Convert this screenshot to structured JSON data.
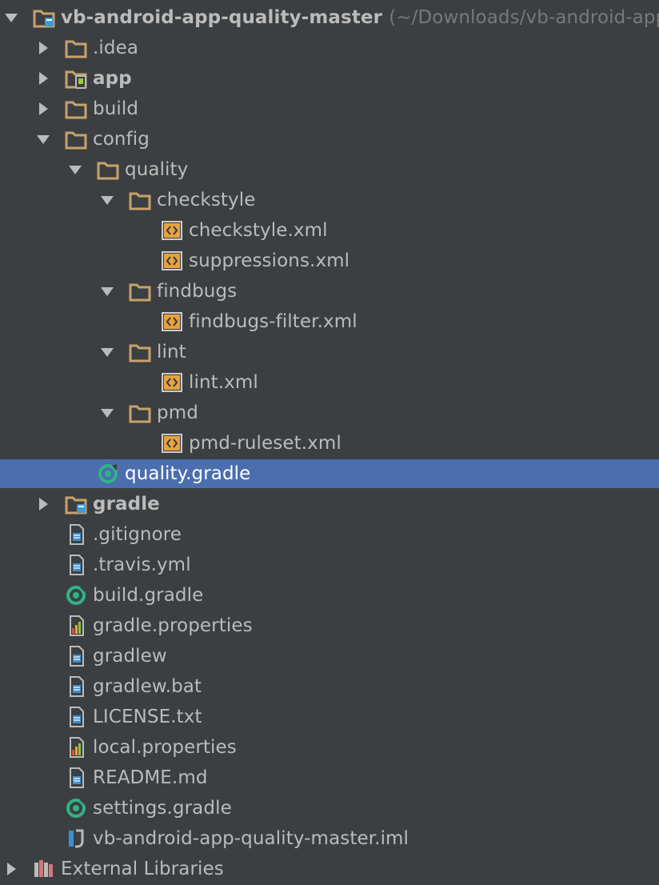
{
  "tree": [
    {
      "label": "vb-android-app-quality-master",
      "path": "(~/Downloads/vb-android-app-quality-master)",
      "icon": "project-module-icon",
      "depth": 0,
      "expand": "open",
      "bold": true
    },
    {
      "label": ".idea",
      "icon": "folder-icon",
      "depth": 1,
      "expand": "closed"
    },
    {
      "label": "app",
      "icon": "android-module-icon",
      "depth": 1,
      "expand": "closed",
      "bold": true
    },
    {
      "label": "build",
      "icon": "folder-icon",
      "depth": 1,
      "expand": "closed"
    },
    {
      "label": "config",
      "icon": "folder-icon",
      "depth": 1,
      "expand": "open"
    },
    {
      "label": "quality",
      "icon": "folder-icon",
      "depth": 2,
      "expand": "open"
    },
    {
      "label": "checkstyle",
      "icon": "folder-icon",
      "depth": 3,
      "expand": "open"
    },
    {
      "label": "checkstyle.xml",
      "icon": "xml-file-icon",
      "depth": 4
    },
    {
      "label": "suppressions.xml",
      "icon": "xml-file-icon",
      "depth": 4
    },
    {
      "label": "findbugs",
      "icon": "folder-icon",
      "depth": 3,
      "expand": "open"
    },
    {
      "label": "findbugs-filter.xml",
      "icon": "xml-file-icon",
      "depth": 4
    },
    {
      "label": "lint",
      "icon": "folder-icon",
      "depth": 3,
      "expand": "open"
    },
    {
      "label": "lint.xml",
      "icon": "xml-file-icon",
      "depth": 4
    },
    {
      "label": "pmd",
      "icon": "folder-icon",
      "depth": 3,
      "expand": "open"
    },
    {
      "label": "pmd-ruleset.xml",
      "icon": "xml-file-icon",
      "depth": 4
    },
    {
      "label": "quality.gradle",
      "icon": "gradle-file-icon",
      "depth": 2,
      "selected": true
    },
    {
      "label": "gradle",
      "icon": "gradle-module-icon",
      "depth": 1,
      "expand": "closed",
      "bold": true
    },
    {
      "label": ".gitignore",
      "icon": "text-file-icon",
      "depth": 1
    },
    {
      "label": ".travis.yml",
      "icon": "text-file-icon",
      "depth": 1
    },
    {
      "label": "build.gradle",
      "icon": "gradle-file-icon",
      "depth": 1
    },
    {
      "label": "gradle.properties",
      "icon": "properties-file-icon",
      "depth": 1
    },
    {
      "label": "gradlew",
      "icon": "text-file-icon",
      "depth": 1
    },
    {
      "label": "gradlew.bat",
      "icon": "text-file-icon",
      "depth": 1
    },
    {
      "label": "LICENSE.txt",
      "icon": "text-file-icon",
      "depth": 1
    },
    {
      "label": "local.properties",
      "icon": "properties-file-icon",
      "depth": 1
    },
    {
      "label": "README.md",
      "icon": "text-file-icon",
      "depth": 1
    },
    {
      "label": "settings.gradle",
      "icon": "gradle-file-icon",
      "depth": 1
    },
    {
      "label": "vb-android-app-quality-master.iml",
      "icon": "iml-file-icon",
      "depth": 1
    },
    {
      "label": "External Libraries",
      "icon": "libraries-icon",
      "depth": 0,
      "expand": "closed"
    }
  ],
  "colors": {
    "background": "#3c3f41",
    "selection": "#4b6eaf",
    "text": "#bbbbbb",
    "folder": "#c9a26b",
    "xml_icon": "#e8a33d",
    "gradle_icon": "#2fb386"
  }
}
